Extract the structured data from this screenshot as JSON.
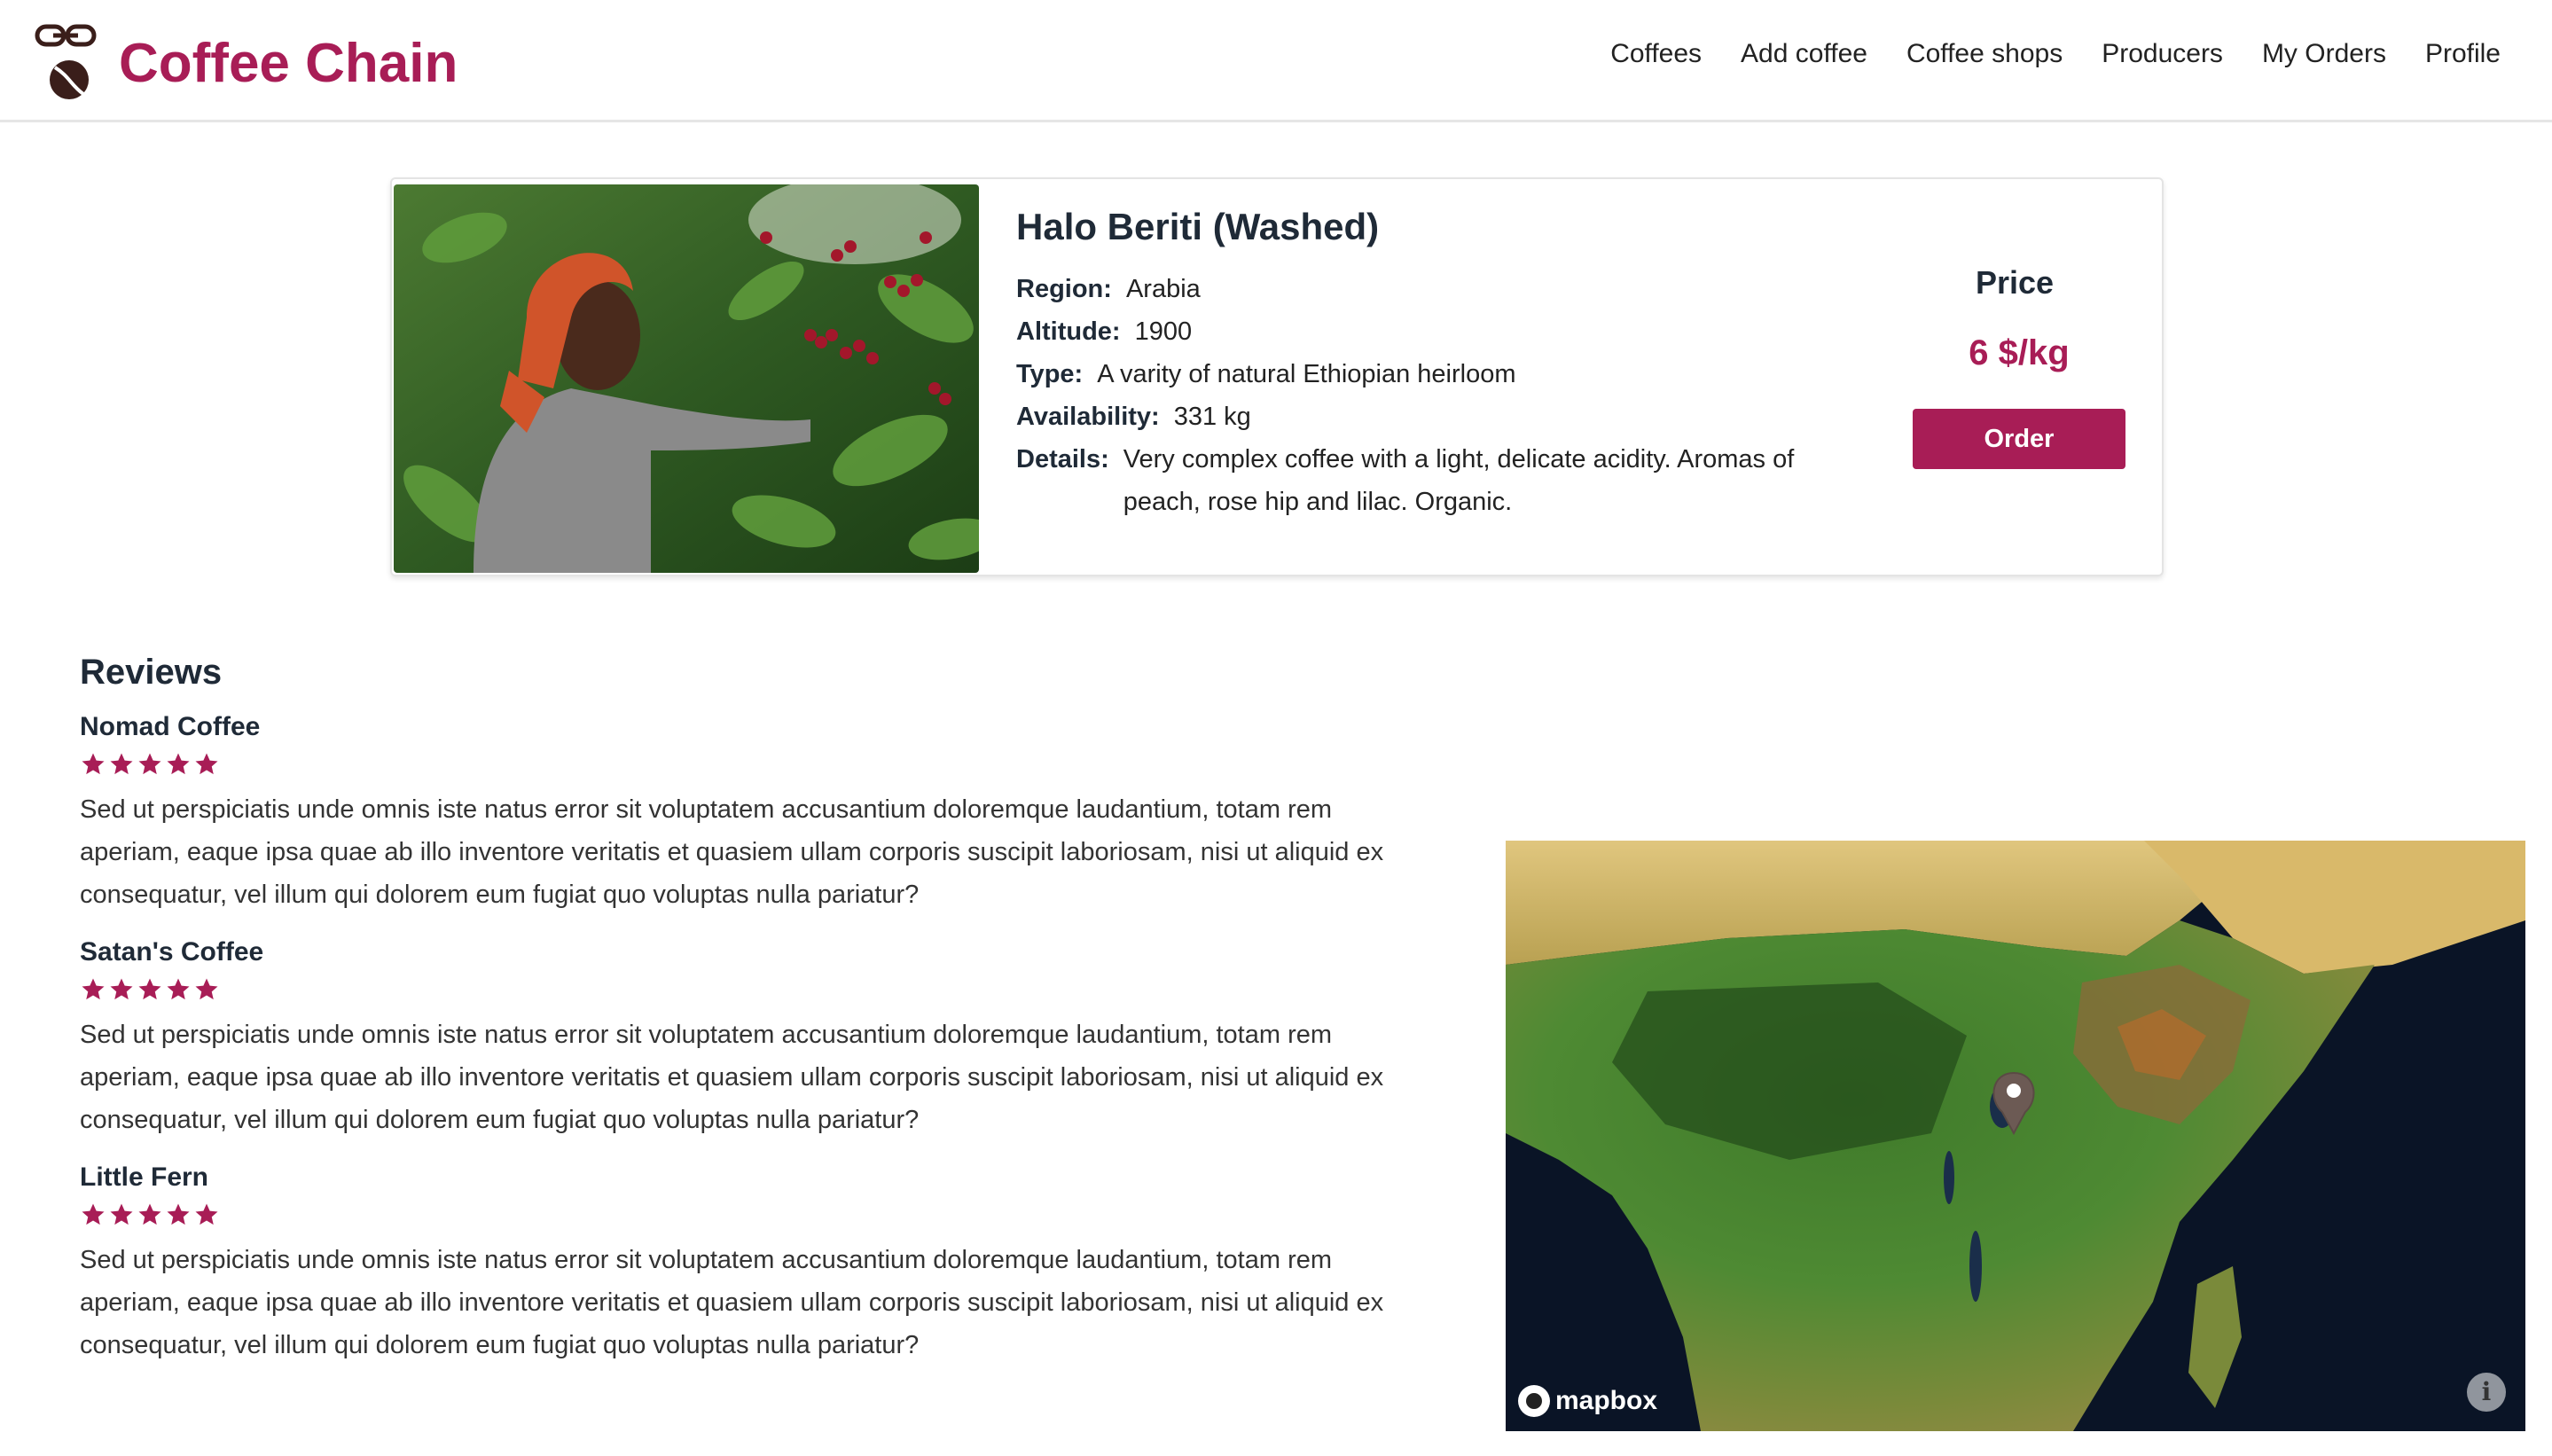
{
  "header": {
    "brand": "Coffee Chain",
    "nav": [
      "Coffees",
      "Add coffee",
      "Coffee shops",
      "Producers",
      "My Orders",
      "Profile"
    ]
  },
  "product": {
    "title": "Halo Beriti (Washed)",
    "fields": [
      {
        "label": "Region:",
        "value": "Arabia"
      },
      {
        "label": "Altitude:",
        "value": "1900"
      },
      {
        "label": "Type:",
        "value": "A varity of natural Ethiopian heirloom"
      },
      {
        "label": "Availability:",
        "value": "331 kg"
      },
      {
        "label": "Details:",
        "value": "Very complex coffee with a light, delicate acidity. Aromas of peach, rose hip and lilac. Organic."
      }
    ],
    "price_label": "Price",
    "price_value": "6 $/kg",
    "order_label": "Order"
  },
  "reviews": {
    "heading": "Reviews",
    "items": [
      {
        "author": "Nomad Coffee",
        "rating": 5,
        "text": "Sed ut perspiciatis unde omnis iste natus error sit voluptatem accusantium doloremque laudantium, totam rem aperiam, eaque ipsa quae ab illo inventore veritatis et quasiem ullam corporis suscipit laboriosam, nisi ut aliquid ex consequatur, vel illum qui dolorem eum fugiat quo voluptas nulla pariatur?"
      },
      {
        "author": "Satan's Coffee",
        "rating": 5,
        "text": "Sed ut perspiciatis unde omnis iste natus error sit voluptatem accusantium doloremque laudantium, totam rem aperiam, eaque ipsa quae ab illo inventore veritatis et quasiem ullam corporis suscipit laboriosam, nisi ut aliquid ex consequatur, vel illum qui dolorem eum fugiat quo voluptas nulla pariatur?"
      },
      {
        "author": "Little Fern",
        "rating": 5,
        "text": "Sed ut perspiciatis unde omnis iste natus error sit voluptatem accusantium doloremque laudantium, totam rem aperiam, eaque ipsa quae ab illo inventore veritatis et quasiem ullam corporis suscipit laboriosam, nisi ut aliquid ex consequatur, vel illum qui dolorem eum fugiat quo voluptas nulla pariatur?"
      }
    ]
  },
  "map": {
    "attribution": "mapbox",
    "info_icon": "i"
  },
  "colors": {
    "accent": "#a81d56",
    "heading": "#1f2a37"
  },
  "icons": [
    "coffee-chain-logo-icon",
    "star-icon",
    "map-pin-icon",
    "mapbox-logo-icon",
    "info-icon"
  ]
}
